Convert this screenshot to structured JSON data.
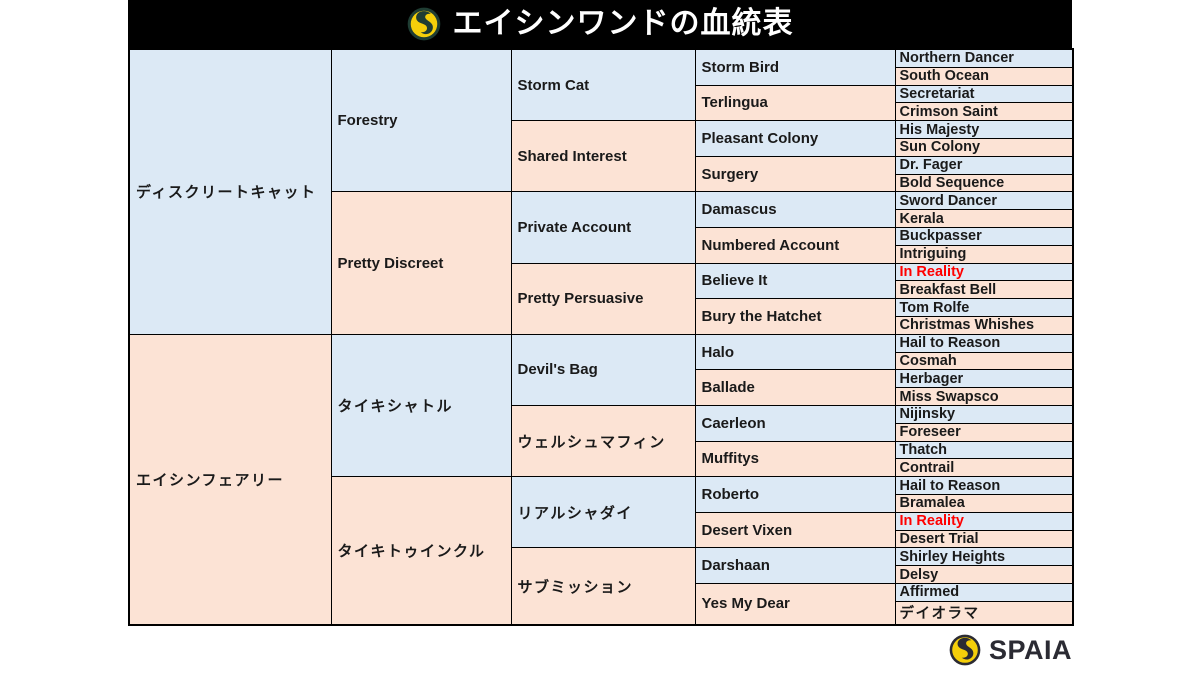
{
  "header": {
    "title": "エイシンワンドの血統表",
    "logo_icon": "spaia-swirl-logo-icon",
    "background_color": "#000000",
    "text_color": "#ffffff"
  },
  "colors": {
    "sire_blue": "#dce9f5",
    "dam_peach": "#fce3d5",
    "border": "#000000",
    "inbreeding_red": "#ff0000",
    "logo_gold": "#f5cf0a",
    "logo_ring": "#1f3d33"
  },
  "footer": {
    "brand": "SPAIA",
    "logo_icon": "spaia-swirl-logo-icon"
  },
  "pedigree": {
    "generation1": [
      {
        "name": "ディスクリートキャット",
        "side": "sire",
        "lang": "ja"
      },
      {
        "name": "エイシンフェアリー",
        "side": "dam",
        "lang": "ja"
      }
    ],
    "generation2": [
      {
        "name": "Forestry",
        "side": "sire",
        "lang": "en"
      },
      {
        "name": "Pretty Discreet",
        "side": "dam",
        "lang": "en"
      },
      {
        "name": "タイキシャトル",
        "side": "sire",
        "lang": "ja"
      },
      {
        "name": "タイキトゥインクル",
        "side": "dam",
        "lang": "ja"
      }
    ],
    "generation3": [
      {
        "name": "Storm Cat",
        "side": "sire",
        "lang": "en"
      },
      {
        "name": "Shared Interest",
        "side": "dam",
        "lang": "en"
      },
      {
        "name": "Private Account",
        "side": "sire",
        "lang": "en"
      },
      {
        "name": "Pretty Persuasive",
        "side": "dam",
        "lang": "en"
      },
      {
        "name": "Devil's Bag",
        "side": "sire",
        "lang": "en"
      },
      {
        "name": "ウェルシュマフィン",
        "side": "dam",
        "lang": "ja"
      },
      {
        "name": "リアルシャダイ",
        "side": "sire",
        "lang": "ja"
      },
      {
        "name": "サブミッション",
        "side": "dam",
        "lang": "ja"
      }
    ],
    "generation4": [
      {
        "name": "Storm Bird",
        "side": "sire",
        "lang": "en"
      },
      {
        "name": "Terlingua",
        "side": "dam",
        "lang": "en"
      },
      {
        "name": "Pleasant Colony",
        "side": "sire",
        "lang": "en"
      },
      {
        "name": "Surgery",
        "side": "dam",
        "lang": "en"
      },
      {
        "name": "Damascus",
        "side": "sire",
        "lang": "en"
      },
      {
        "name": "Numbered Account",
        "side": "dam",
        "lang": "en"
      },
      {
        "name": "Believe It",
        "side": "sire",
        "lang": "en"
      },
      {
        "name": "Bury the Hatchet",
        "side": "dam",
        "lang": "en"
      },
      {
        "name": "Halo",
        "side": "sire",
        "lang": "en"
      },
      {
        "name": "Ballade",
        "side": "dam",
        "lang": "en"
      },
      {
        "name": "Caerleon",
        "side": "sire",
        "lang": "en"
      },
      {
        "name": "Muffitys",
        "side": "dam",
        "lang": "en"
      },
      {
        "name": "Roberto",
        "side": "sire",
        "lang": "en"
      },
      {
        "name": "Desert Vixen",
        "side": "dam",
        "lang": "en"
      },
      {
        "name": "Darshaan",
        "side": "sire",
        "lang": "en"
      },
      {
        "name": "Yes My Dear",
        "side": "dam",
        "lang": "en"
      }
    ],
    "generation5": [
      {
        "name": "Northern Dancer",
        "side": "sire",
        "highlight": false
      },
      {
        "name": "South Ocean",
        "side": "dam",
        "highlight": false
      },
      {
        "name": "Secretariat",
        "side": "sire",
        "highlight": false
      },
      {
        "name": "Crimson Saint",
        "side": "dam",
        "highlight": false
      },
      {
        "name": "His Majesty",
        "side": "sire",
        "highlight": false
      },
      {
        "name": "Sun Colony",
        "side": "dam",
        "highlight": false
      },
      {
        "name": "Dr. Fager",
        "side": "sire",
        "highlight": false
      },
      {
        "name": "Bold Sequence",
        "side": "dam",
        "highlight": false
      },
      {
        "name": "Sword Dancer",
        "side": "sire",
        "highlight": false
      },
      {
        "name": "Kerala",
        "side": "dam",
        "highlight": false
      },
      {
        "name": "Buckpasser",
        "side": "sire",
        "highlight": false
      },
      {
        "name": "Intriguing",
        "side": "dam",
        "highlight": false
      },
      {
        "name": "In Reality",
        "side": "sire",
        "highlight": true
      },
      {
        "name": "Breakfast Bell",
        "side": "dam",
        "highlight": false
      },
      {
        "name": "Tom Rolfe",
        "side": "sire",
        "highlight": false
      },
      {
        "name": "Christmas Whishes",
        "side": "dam",
        "highlight": false
      },
      {
        "name": "Hail to Reason",
        "side": "sire",
        "highlight": false
      },
      {
        "name": "Cosmah",
        "side": "dam",
        "highlight": false
      },
      {
        "name": "Herbager",
        "side": "sire",
        "highlight": false
      },
      {
        "name": "Miss Swapsco",
        "side": "dam",
        "highlight": false
      },
      {
        "name": "Nijinsky",
        "side": "sire",
        "highlight": false
      },
      {
        "name": "Foreseer",
        "side": "dam",
        "highlight": false
      },
      {
        "name": "Thatch",
        "side": "sire",
        "highlight": false
      },
      {
        "name": "Contrail",
        "side": "dam",
        "highlight": false
      },
      {
        "name": "Hail to Reason",
        "side": "sire",
        "highlight": false
      },
      {
        "name": "Bramalea",
        "side": "dam",
        "highlight": false
      },
      {
        "name": "In Reality",
        "side": "sire",
        "highlight": true
      },
      {
        "name": "Desert Trial",
        "side": "dam",
        "highlight": false
      },
      {
        "name": "Shirley Heights",
        "side": "sire",
        "highlight": false
      },
      {
        "name": "Delsy",
        "side": "dam",
        "highlight": false
      },
      {
        "name": "Affirmed",
        "side": "sire",
        "highlight": false
      },
      {
        "name": "デイオラマ",
        "side": "dam",
        "highlight": false
      }
    ]
  }
}
